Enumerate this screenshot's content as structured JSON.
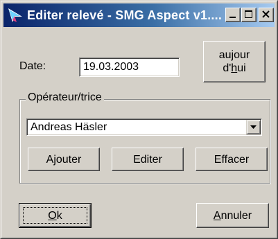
{
  "window": {
    "title": "Editer relevé - SMG Aspect v1...."
  },
  "date": {
    "label": "Date:",
    "value": "19.03.2003"
  },
  "today_button": {
    "line1": "aujour",
    "line2_pre": "d'",
    "line2_underlined": "h",
    "line2_post": "ui"
  },
  "operator_group": {
    "legend": "Opérateur/trice",
    "selected": "Andreas Häsler",
    "buttons": {
      "add": "Ajouter",
      "edit": "Editer",
      "delete": "Effacer"
    }
  },
  "footer": {
    "ok_underlined": "O",
    "ok_rest": "k",
    "cancel_underlined": "A",
    "cancel_rest": "nnuler"
  },
  "colors": {
    "dialog_bg": "#d4d0c8",
    "titlebar_start": "#0a246a",
    "titlebar_end": "#a6caf0"
  }
}
